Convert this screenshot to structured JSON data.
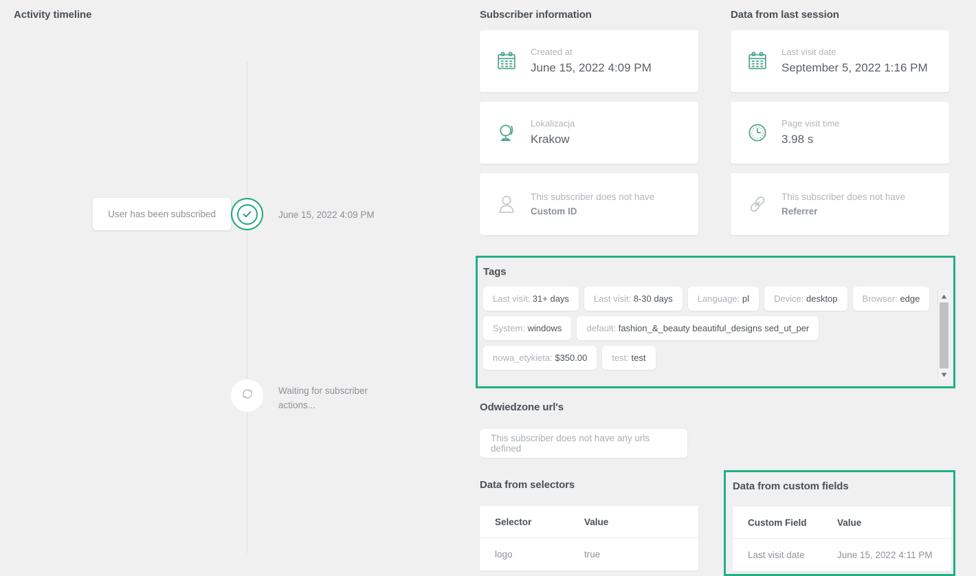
{
  "timeline": {
    "title": "Activity timeline",
    "events": [
      {
        "label": "User has been subscribed",
        "time": "June 15, 2022 4:09 PM",
        "marker": "check-icon",
        "state": "done"
      },
      {
        "label": "",
        "time": "Waiting for subscriber actions...",
        "marker": "refresh-icon",
        "state": "pending"
      }
    ]
  },
  "subscriber_information": {
    "title": "Subscriber information",
    "cards": [
      {
        "icon": "calendar-icon",
        "label": "Created at",
        "value": "June 15, 2022 4:09 PM",
        "empty": false
      },
      {
        "icon": "globe-icon",
        "label": "Lokalizacja",
        "value": "Krakow",
        "empty": false
      },
      {
        "icon": "user-icon",
        "empty": true,
        "empty_prefix": "This subscriber does not have ",
        "empty_strong": "Custom ID"
      }
    ]
  },
  "last_session": {
    "title": "Data from last session",
    "cards": [
      {
        "icon": "calendar-icon",
        "label": "Last visit date",
        "value": "September 5, 2022 1:16 PM",
        "empty": false
      },
      {
        "icon": "clock-icon",
        "label": "Page visit time",
        "value": "3.98 s",
        "empty": false
      },
      {
        "icon": "link-icon",
        "empty": true,
        "empty_prefix": "This subscriber does not have ",
        "empty_strong": "Referrer"
      }
    ]
  },
  "tags": {
    "title": "Tags",
    "highlight_color": "#21b086",
    "items": [
      {
        "key": "Last visit:",
        "value": "31+ days"
      },
      {
        "key": "Last visit:",
        "value": "8-30 days"
      },
      {
        "key": "Language:",
        "value": "pl"
      },
      {
        "key": "Device:",
        "value": "desktop"
      },
      {
        "key": "Browser:",
        "value": "edge"
      },
      {
        "key": "System:",
        "value": "windows"
      },
      {
        "key": "default:",
        "value": "fashion_&_beauty beautiful_designs sed_ut_per"
      },
      {
        "key": "nowa_etykieta:",
        "value": "$350.00"
      },
      {
        "key": "test:",
        "value": "test"
      }
    ]
  },
  "urls": {
    "title": "Odwiedzone url's",
    "empty_text": "This subscriber does not have any urls defined"
  },
  "selectors_table": {
    "title": "Data from selectors",
    "columns": [
      "Selector",
      "Value"
    ],
    "rows": [
      [
        "logo",
        "true"
      ]
    ]
  },
  "custom_fields_table": {
    "title": "Data from custom fields",
    "highlight_color": "#21b086",
    "columns": [
      "Custom Field",
      "Value"
    ],
    "rows": [
      [
        "Last visit date",
        "June 15, 2022 4:11 PM"
      ]
    ]
  }
}
